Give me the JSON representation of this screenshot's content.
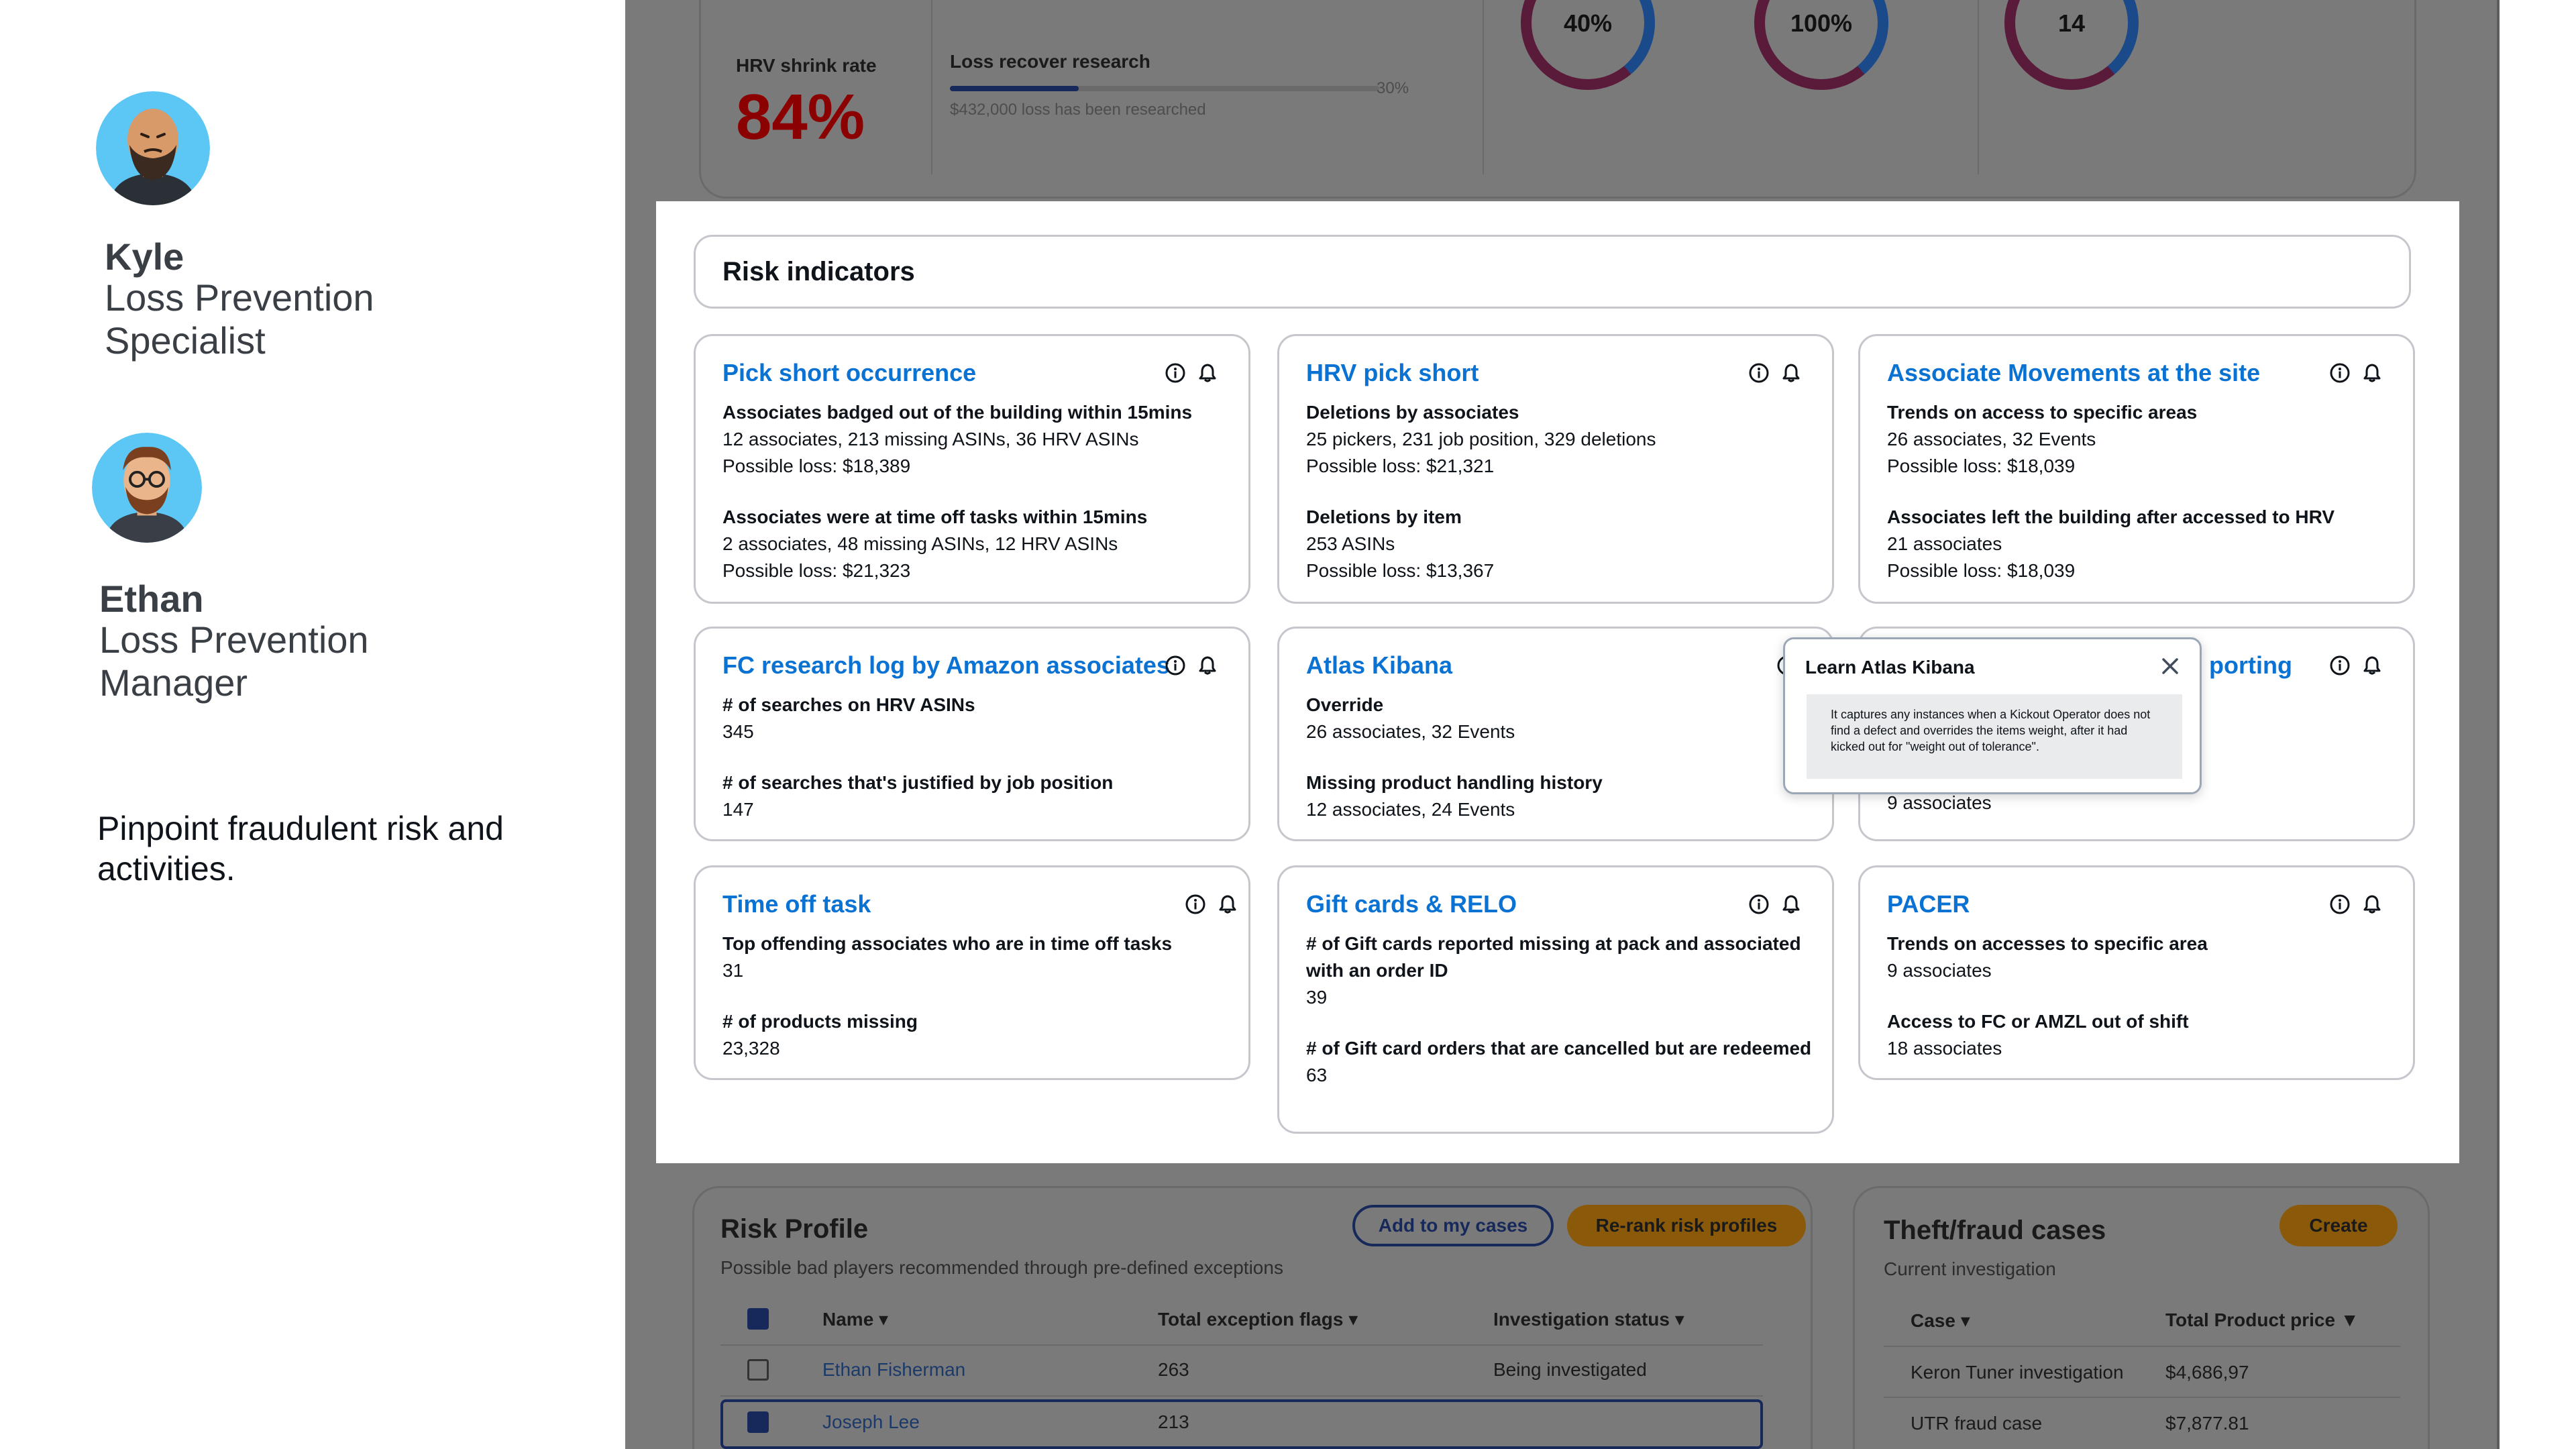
{
  "personas": [
    {
      "name": "Kyle",
      "role": "Loss Prevention Specialist"
    },
    {
      "name": "Ethan",
      "role": "Loss Prevention Manager"
    }
  ],
  "tagline": "Pinpoint fraudulent risk and activities.",
  "top_metrics": {
    "hrv_shrink_label": "HRV shrink rate",
    "hrv_shrink_value": "84%",
    "loss_recover_label": "Loss recover research",
    "loss_recover_percent": "30%",
    "loss_recover_fraction": 0.3,
    "loss_recover_note": "$432,000 loss has been researched",
    "donuts": [
      "40%",
      "100%",
      "14"
    ]
  },
  "risk_indicators": {
    "title": "Risk indicators",
    "cards": [
      {
        "title": "Pick short occurrence",
        "s1_head": "Associates badged out of the building within 15mins",
        "s1_l1": "12 associates, 213 missing ASINs, 36 HRV ASINs",
        "s1_l2": "Possible loss: $18,389",
        "s2_head": "Associates were at time off tasks within 15mins",
        "s2_l1": "2 associates, 48 missing ASINs, 12 HRV ASINs",
        "s2_l2": "Possible loss: $21,323"
      },
      {
        "title": "HRV pick short",
        "s1_head": "Deletions by associates",
        "s1_l1": "25 pickers, 231 job position, 329 deletions",
        "s1_l2": "Possible loss: $21,321",
        "s2_head": "Deletions by item",
        "s2_l1": "253 ASINs",
        "s2_l2": "Possible loss: $13,367"
      },
      {
        "title": "Associate Movements at the site",
        "s1_head": "Trends on access to specific areas",
        "s1_l1": "26 associates, 32 Events",
        "s1_l2": "Possible loss: $18,039",
        "s2_head": "Associates left the building after accessed to HRV",
        "s2_l1": "21 associates",
        "s2_l2": "Possible loss: $18,039"
      },
      {
        "title": "FC research log by Amazon associates",
        "s1_head": "# of searches on HRV ASINs",
        "s1_l1": "345",
        "s2_head": "# of searches that's justified by job position",
        "s2_l1": "147"
      },
      {
        "title": "Atlas Kibana",
        "s1_head": "Override",
        "s1_l1": "26 associates, 32 Events",
        "s2_head": "Missing product handling history",
        "s2_l1": "12 associates, 24 Events"
      },
      {
        "title": "porting",
        "s2_l1": "9 associates"
      },
      {
        "title": "Time off task",
        "s1_head": "Top offending associates who are in time off tasks",
        "s1_l1": "31",
        "s2_head": "# of products missing",
        "s2_l1": "23,328"
      },
      {
        "title": "Gift cards & RELO",
        "s1_head": "# of Gift cards reported missing at pack and associated with an order ID",
        "s1_l1": "39",
        "s2_head": "# of Gift card orders that are cancelled  but are redeemed",
        "s2_l1": "63"
      },
      {
        "title": "PACER",
        "s1_head": "Trends on accesses to specific area",
        "s1_l1": "9 associates",
        "s2_head": "Access to FC or AMZL out of shift",
        "s2_l1": "18 associates"
      }
    ]
  },
  "popover": {
    "title": "Learn Atlas Kibana",
    "body": "It captures any instances when a Kickout Operator does not find a defect and overrides the items weight, after it had kicked out for \"weight out of tolerance\"."
  },
  "risk_profile": {
    "title": "Risk Profile",
    "subtitle": "Possible bad players recommended through pre-defined exceptions",
    "add_button": "Add to my cases",
    "rerank_button": "Re-rank risk profiles",
    "columns": [
      "Name",
      "Total exception flags",
      "Investigation status"
    ],
    "rows": [
      {
        "name": "Ethan Fisherman",
        "flags": "263",
        "status": "Being investigated",
        "checked": false
      },
      {
        "name": "Joseph Lee",
        "flags": "213",
        "status": "",
        "checked": true
      }
    ]
  },
  "theft_cases": {
    "title": "Theft/fraud cases",
    "subtitle": "Current investigation",
    "create_button": "Create",
    "columns": [
      "Case",
      "Total Product price"
    ],
    "rows": [
      {
        "case": "Keron Tuner investigation",
        "price": "$4,686,97"
      },
      {
        "case": "UTR fraud case",
        "price": "$7,877.81"
      }
    ]
  },
  "colors": {
    "link_blue": "#0972d3",
    "shrink_red": "#8b0000",
    "dim_bg": "#7a7a7a"
  }
}
